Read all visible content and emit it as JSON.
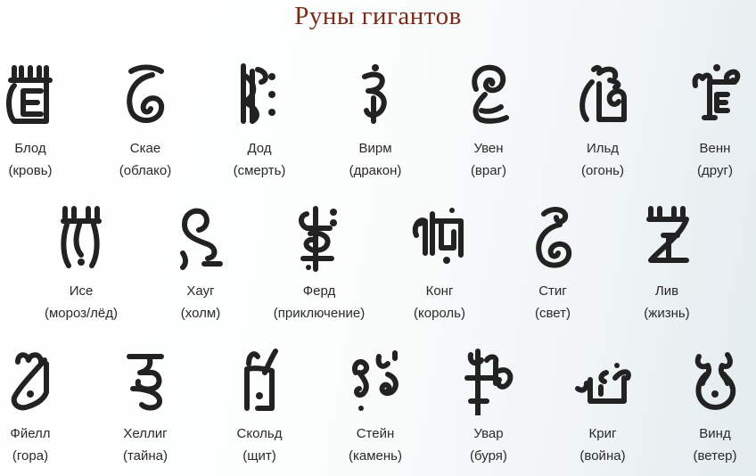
{
  "title": "Руны гигантов",
  "runes": [
    {
      "name": "Блод",
      "meaning": "(кровь)",
      "icon": "blod-rune-icon"
    },
    {
      "name": "Скае",
      "meaning": "(облако)",
      "icon": "skae-rune-icon"
    },
    {
      "name": "Дод",
      "meaning": "(смерть)",
      "icon": "dod-rune-icon"
    },
    {
      "name": "Вирм",
      "meaning": "(дракон)",
      "icon": "wyrm-rune-icon"
    },
    {
      "name": "Увен",
      "meaning": "(враг)",
      "icon": "uven-rune-icon"
    },
    {
      "name": "Ильд",
      "meaning": "(огонь)",
      "icon": "ild-rune-icon"
    },
    {
      "name": "Венн",
      "meaning": "(друг)",
      "icon": "venn-rune-icon"
    },
    {
      "name": "Исе",
      "meaning": "(мороз/лёд)",
      "icon": "ise-rune-icon"
    },
    {
      "name": "Хауг",
      "meaning": "(холм)",
      "icon": "haug-rune-icon"
    },
    {
      "name": "Ферд",
      "meaning": "(приключение)",
      "icon": "ferd-rune-icon"
    },
    {
      "name": "Конг",
      "meaning": "(король)",
      "icon": "kong-rune-icon"
    },
    {
      "name": "Стиг",
      "meaning": "(свет)",
      "icon": "stig-rune-icon"
    },
    {
      "name": "Лив",
      "meaning": "(жизнь)",
      "icon": "liv-rune-icon"
    },
    {
      "name": "Фйелл",
      "meaning": "(гора)",
      "icon": "fjell-rune-icon"
    },
    {
      "name": "Хеллиг",
      "meaning": "(тайна)",
      "icon": "hellig-rune-icon"
    },
    {
      "name": "Скольд",
      "meaning": "(щит)",
      "icon": "skold-rune-icon"
    },
    {
      "name": "Стейн",
      "meaning": "(камень)",
      "icon": "stein-rune-icon"
    },
    {
      "name": "Увар",
      "meaning": "(буря)",
      "icon": "uvar-rune-icon"
    },
    {
      "name": "Криг",
      "meaning": "(война)",
      "icon": "krig-rune-icon"
    },
    {
      "name": "Винд",
      "meaning": "(ветер)",
      "icon": "vind-rune-icon"
    }
  ]
}
